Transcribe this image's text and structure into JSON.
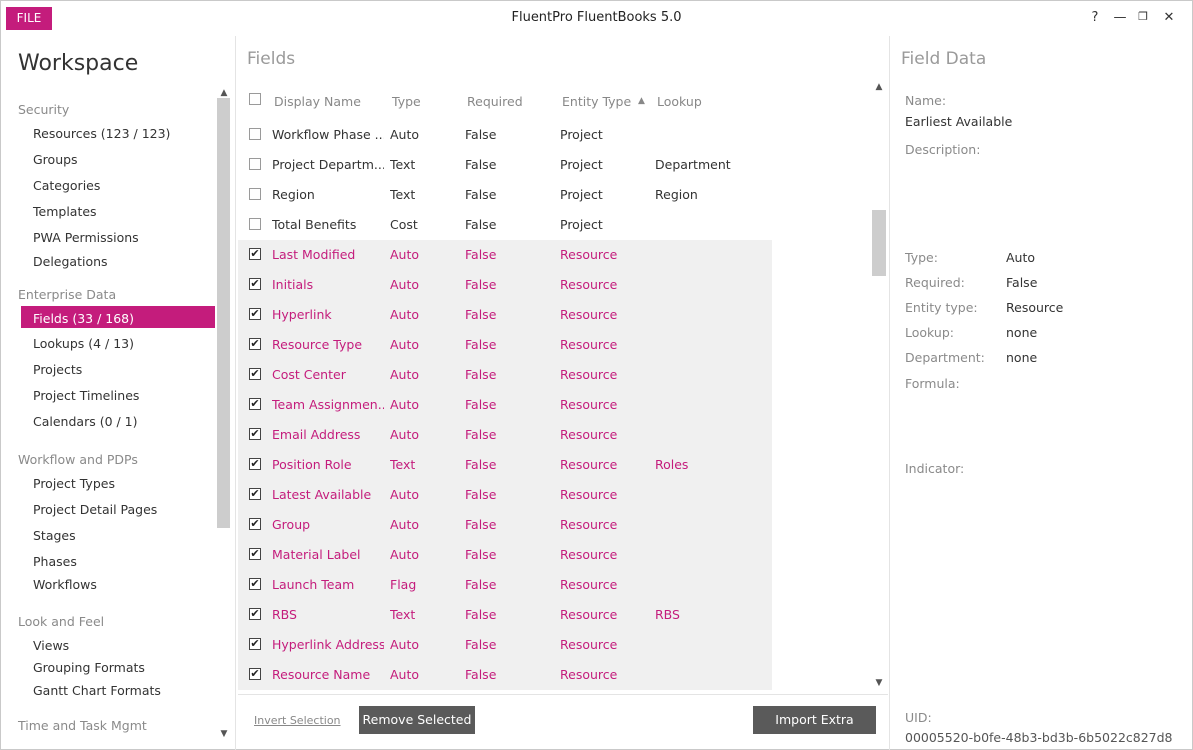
{
  "titlebar": {
    "file_label": "FILE",
    "app_title": "FluentPro FluentBooks 5.0",
    "help": "?",
    "minimize": "—",
    "restore": "❐",
    "close": "✕"
  },
  "sidebar": {
    "title": "Workspace",
    "groups": [
      {
        "label": "Security",
        "items": [
          "Resources (123 / 123)",
          "Groups",
          "Categories",
          "Templates",
          "PWA Permissions",
          "Delegations"
        ]
      },
      {
        "label": "Enterprise Data",
        "items": [
          "Fields (33 / 168)",
          "Lookups (4 / 13)",
          "Projects",
          "Project Timelines",
          "Calendars (0 / 1)"
        ]
      },
      {
        "label": "Workflow and PDPs",
        "items": [
          "Project Types",
          "Project Detail Pages",
          "Stages",
          "Phases",
          "Workflows"
        ]
      },
      {
        "label": "Look and Feel",
        "items": [
          "Views",
          "Grouping Formats",
          "Gantt Chart Formats"
        ]
      },
      {
        "label": "Time and Task Mgmt",
        "items": []
      }
    ],
    "active_item": "Fields (33 / 168)"
  },
  "fields": {
    "title": "Fields",
    "columns": [
      "Display Name",
      "Type",
      "Required",
      "Entity Type",
      "Lookup"
    ],
    "sort_indicator": "▲",
    "rows": [
      {
        "name": "Workflow Phase ...",
        "type": "Auto",
        "required": "False",
        "entity": "Project",
        "lookup": "",
        "checked": false
      },
      {
        "name": "Project Departm...",
        "type": "Text",
        "required": "False",
        "entity": "Project",
        "lookup": "Department",
        "checked": false
      },
      {
        "name": "Region",
        "type": "Text",
        "required": "False",
        "entity": "Project",
        "lookup": "Region",
        "checked": false
      },
      {
        "name": "Total Benefits",
        "type": "Cost",
        "required": "False",
        "entity": "Project",
        "lookup": "",
        "checked": false
      },
      {
        "name": "Last Modified",
        "type": "Auto",
        "required": "False",
        "entity": "Resource",
        "lookup": "",
        "checked": true
      },
      {
        "name": "Initials",
        "type": "Auto",
        "required": "False",
        "entity": "Resource",
        "lookup": "",
        "checked": true
      },
      {
        "name": "Hyperlink",
        "type": "Auto",
        "required": "False",
        "entity": "Resource",
        "lookup": "",
        "checked": true
      },
      {
        "name": "Resource Type",
        "type": "Auto",
        "required": "False",
        "entity": "Resource",
        "lookup": "",
        "checked": true
      },
      {
        "name": "Cost Center",
        "type": "Auto",
        "required": "False",
        "entity": "Resource",
        "lookup": "",
        "checked": true
      },
      {
        "name": "Team Assignmen...",
        "type": "Auto",
        "required": "False",
        "entity": "Resource",
        "lookup": "",
        "checked": true
      },
      {
        "name": "Email Address",
        "type": "Auto",
        "required": "False",
        "entity": "Resource",
        "lookup": "",
        "checked": true
      },
      {
        "name": "Position Role",
        "type": "Text",
        "required": "False",
        "entity": "Resource",
        "lookup": "Roles",
        "checked": true
      },
      {
        "name": "Latest Available",
        "type": "Auto",
        "required": "False",
        "entity": "Resource",
        "lookup": "",
        "checked": true
      },
      {
        "name": "Group",
        "type": "Auto",
        "required": "False",
        "entity": "Resource",
        "lookup": "",
        "checked": true
      },
      {
        "name": "Material Label",
        "type": "Auto",
        "required": "False",
        "entity": "Resource",
        "lookup": "",
        "checked": true
      },
      {
        "name": "Launch Team",
        "type": "Flag",
        "required": "False",
        "entity": "Resource",
        "lookup": "",
        "checked": true
      },
      {
        "name": "RBS",
        "type": "Text",
        "required": "False",
        "entity": "Resource",
        "lookup": "RBS",
        "checked": true
      },
      {
        "name": "Hyperlink Address",
        "type": "Auto",
        "required": "False",
        "entity": "Resource",
        "lookup": "",
        "checked": true
      },
      {
        "name": "Resource Name",
        "type": "Auto",
        "required": "False",
        "entity": "Resource",
        "lookup": "",
        "checked": true
      }
    ],
    "invert_selection": "Invert Selection",
    "remove_selected": "Remove Selected",
    "import_extra": "Import Extra"
  },
  "field_data": {
    "title": "Field Data",
    "name_label": "Name:",
    "name_value": "Earliest Available",
    "description_label": "Description:",
    "type_label": "Type:",
    "type_value": "Auto",
    "required_label": "Required:",
    "required_value": "False",
    "entity_label": "Entity type:",
    "entity_value": "Resource",
    "lookup_label": "Lookup:",
    "lookup_value": "none",
    "department_label": "Department:",
    "department_value": "none",
    "formula_label": "Formula:",
    "indicator_label": "Indicator:",
    "uid_label": "UID:",
    "uid_value": "00005520-b0fe-48b3-bd3b-6b5022c827d8"
  },
  "colors": {
    "accent": "#c41c7c",
    "button_dark": "#5a5a5a",
    "selected_row_bg": "#f0f0f0"
  }
}
